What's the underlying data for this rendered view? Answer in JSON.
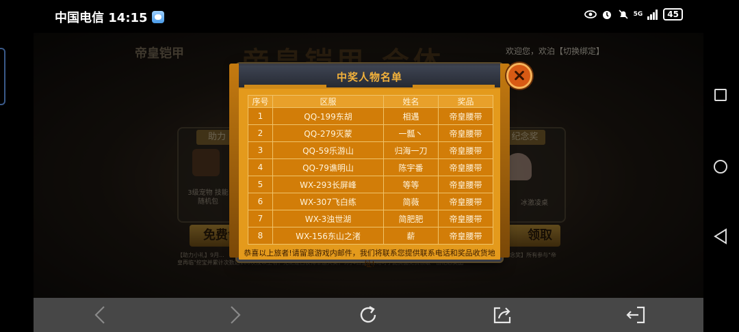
{
  "status_bar": {
    "carrier_time": "中国电信 14:15",
    "network": "5G",
    "battery": "45"
  },
  "background_page": {
    "welcome_text": "欢迎您，欢泊【切换绑定】",
    "logo_text": "帝皇铠甲",
    "title_text": "帝皇铠甲 合体",
    "left_tab": "助力",
    "right_tab": "纪念奖",
    "left_reward_label": "3级宠物 技能随机包",
    "right_reward_label": "冰激凌桌",
    "left_button": "免费领",
    "right_button": "领取",
    "rules_text": "【助力小礼】9月...  【幸运大奖】截至...  全部名单将于9月4日公布，公布后获奖玩家将收到系统邮件，请写获奖地址的奖品寄出  【参与纪念奖】所有参与\"帝皇再临\"挖宝并累计次数达100次及以上者，无论是否获得幸运大奖，9月4日至6日均可于此页面免费领取一份纪念奖品"
  },
  "modal": {
    "title": "中奖人物名单",
    "columns": [
      "序号",
      "区服",
      "姓名",
      "奖品"
    ],
    "rows": [
      [
        "1",
        "QQ-199东胡",
        "相遇",
        "帝皇腰带"
      ],
      [
        "2",
        "QQ-279灭蒙",
        "一瓢丶",
        "帝皇腰带"
      ],
      [
        "3",
        "QQ-59乐游山",
        "归海一刀",
        "帝皇腰带"
      ],
      [
        "4",
        "QQ-79谯明山",
        "陈宇番",
        "帝皇腰带"
      ],
      [
        "5",
        "WX-293长屏峰",
        "等等",
        "帝皇腰带"
      ],
      [
        "6",
        "WX-307飞白练",
        "简薇",
        "帝皇腰带"
      ],
      [
        "7",
        "WX-3浊世湖",
        "简肥肥",
        "帝皇腰带"
      ],
      [
        "8",
        "WX-156东山之渚",
        "薪",
        "帝皇腰带"
      ]
    ],
    "footer": "恭喜以上旅者!请留意游戏内邮件，我们将联系您提供联系电话和奖品收货地址!"
  },
  "colors": {
    "modal_bg": "#e49a1c",
    "cell_bg": "#d27d08",
    "header_bg": "#2e333d",
    "title_text": "#f2b13b",
    "close_button": "#d85a14",
    "toolbar_bg": "#474747"
  },
  "toolbar": {
    "icons": [
      "back-arrow-icon",
      "forward-arrow-icon",
      "refresh-icon",
      "share-icon",
      "exit-icon"
    ]
  }
}
